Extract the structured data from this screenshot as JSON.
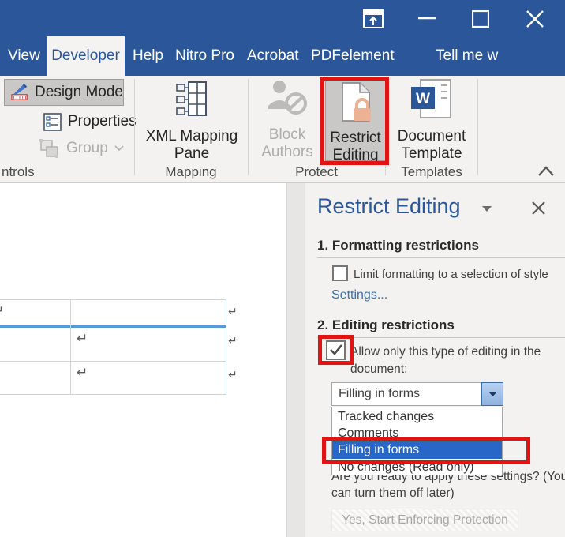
{
  "tabs": {
    "view": "View",
    "developer": "Developer",
    "help": "Help",
    "nitro": "Nitro Pro",
    "acrobat": "Acrobat",
    "pdfelement": "PDFelement",
    "tellme": "Tell me w"
  },
  "ribbon": {
    "design_mode": "Design Mode",
    "properties": "Properties",
    "group": "Group",
    "controls_label": "ntrols",
    "xml_mapping": "XML Mapping Pane",
    "mapping_label": "Mapping",
    "block_authors": "Block Authors",
    "restrict_editing": "Restrict Editing",
    "protect_label": "Protect",
    "document_template": "Document Template",
    "templates_label": "Templates"
  },
  "document": {
    "cell_mark": "↵"
  },
  "pane": {
    "title": "Restrict Editing",
    "formatting": {
      "heading": "1. Formatting restrictions",
      "checkbox_label": "Limit formatting to a selection of style",
      "checked": false,
      "settings_link": "Settings..."
    },
    "editing": {
      "heading": "2. Editing restrictions",
      "checkbox_label": "Allow only this type of editing in the document:",
      "checked": true,
      "dropdown_value": "Filling in forms",
      "options": [
        "Tracked changes",
        "Comments",
        "Filling in forms",
        "No changes (Read only)"
      ],
      "selected_option": "Filling in forms"
    },
    "apply": {
      "question": "Are you ready to apply these settings? (You can turn them off later)",
      "button_label": "Yes, Start Enforcing Protection"
    }
  },
  "colors": {
    "title_blue": "#2B579A",
    "annotation_red": "#E21313",
    "selection_blue": "#2866C8",
    "table_border": "#BDD7EE"
  }
}
